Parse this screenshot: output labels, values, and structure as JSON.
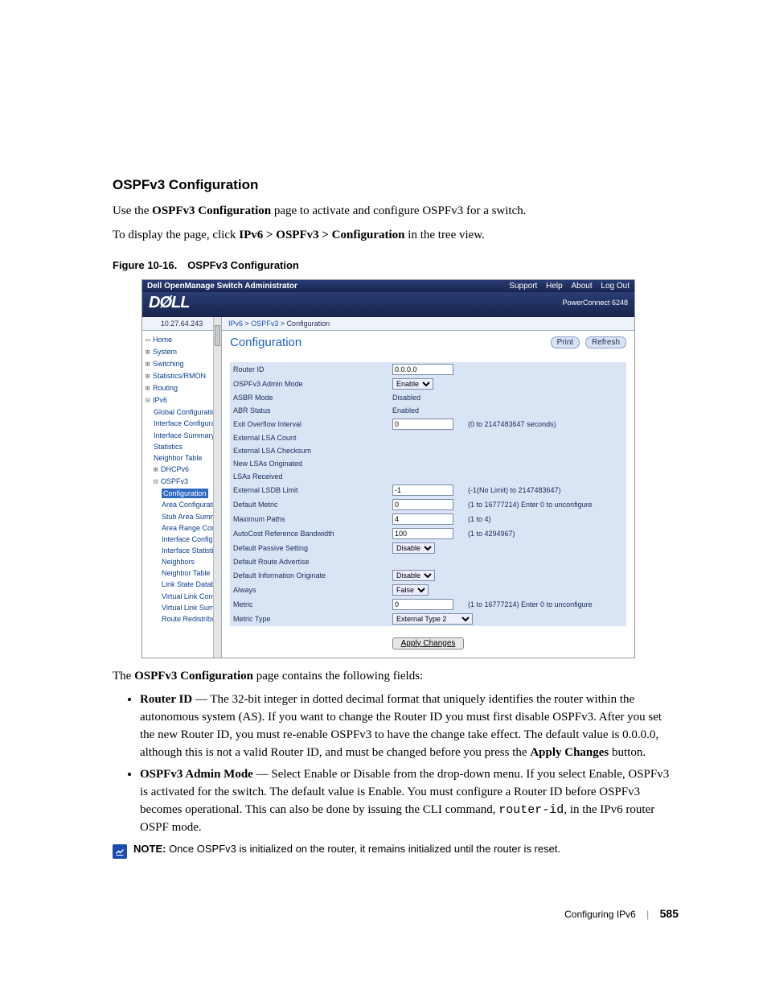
{
  "section_heading": "OSPFv3 Configuration",
  "intro_pre": "Use the ",
  "intro_b": "OSPFv3 Configuration",
  "intro_post": " page to activate and configure OSPFv3 for a switch.",
  "display_pre": "To display the page, click ",
  "display_b": "IPv6 > OSPFv3 > Configuration",
  "display_post": " in the tree view.",
  "figure_caption": "Figure 10-16. OSPFv3 Configuration",
  "shot": {
    "topbar_title": "Dell OpenManage Switch Administrator",
    "topbar_links": {
      "support": "Support",
      "help": "Help",
      "about": "About",
      "logout": "Log Out"
    },
    "logo_text": "DØLL",
    "product": "PowerConnect 6248",
    "ip": "10.27.64.243",
    "breadcrumb": {
      "a": "IPv6",
      "b": "OSPFv3",
      "c": "Configuration"
    },
    "panel_title": "Configuration",
    "panel_print": "Print",
    "panel_refresh": "Refresh",
    "tree": {
      "home": "Home",
      "system": "System",
      "switching": "Switching",
      "stats": "Statistics/RMON",
      "routing": "Routing",
      "ipv6": "IPv6",
      "global": "Global Configuration",
      "ifcfg": "Interface Configurati",
      "ifsum": "Interface Summary",
      "statsn": "Statistics",
      "neigh": "Neighbor Table",
      "dhcpv6": "DHCPv6",
      "ospfv3": "OSPFv3",
      "cfg": "Configuration",
      "areacfg": "Area Configuratio",
      "stubarea": "Stub Area Summ",
      "arearange": "Area Range Conf",
      "ifconf2": "Interface Configu",
      "ifstat2": "Interface Statistic",
      "neighbors": "Neighbors",
      "neightbl": "Neighbor Table",
      "lsdb": "Link State Datab",
      "vlinkconf": "Virtual Link Confi",
      "vlinksum": "Virtual Link Sum",
      "redist": "Route Redistribut"
    },
    "rows": {
      "router_id": {
        "label": "Router ID",
        "value": "0.0.0.0"
      },
      "admin_mode": {
        "label": "OSPFv3 Admin Mode",
        "value": "Enable"
      },
      "asbr_mode": {
        "label": "ASBR Mode",
        "value": "Disabled"
      },
      "abr_status": {
        "label": "ABR Status",
        "value": "Enabled"
      },
      "exit_ovf": {
        "label": "Exit Overflow Interval",
        "value": "0",
        "hint": "(0 to 2147483647 seconds)"
      },
      "ext_lsa": {
        "label": "External LSA Count",
        "value": ""
      },
      "ext_lsa_cks": {
        "label": "External LSA Checksum",
        "value": ""
      },
      "new_lsa": {
        "label": "New LSAs Originated",
        "value": ""
      },
      "lsa_recv": {
        "label": "LSAs Received",
        "value": ""
      },
      "ext_lsdb": {
        "label": "External LSDB Limit",
        "value": "-1",
        "hint": "(-1(No Limit) to 2147483647)"
      },
      "def_metric": {
        "label": "Default Metric",
        "value": "0",
        "hint": "(1 to 16777214) Enter 0 to unconfigure"
      },
      "max_paths": {
        "label": "Maximum Paths",
        "value": "4",
        "hint": "(1 to 4)"
      },
      "auto_bw": {
        "label": "AutoCost Reference Bandwidth",
        "value": "100",
        "hint": "(1 to 4294967)"
      },
      "def_passive": {
        "label": "Default Passive Setting",
        "value": "Disable"
      },
      "def_rt_adv": {
        "label": "Default Route Advertise",
        "value": ""
      },
      "def_info_or": {
        "label": "Default Information Originate",
        "value": "Disable"
      },
      "always": {
        "label": "Always",
        "value": "False"
      },
      "metric": {
        "label": "Metric",
        "value": "0",
        "hint": "(1 to 16777214) Enter 0 to unconfigure"
      },
      "metric_type": {
        "label": "Metric Type",
        "value": "External Type 2"
      }
    },
    "apply": "Apply Changes"
  },
  "fields_intro_pre": "The ",
  "fields_intro_b": "OSPFv3 Configuration",
  "fields_intro_post": " page contains the following fields:",
  "fld1_b": "Router ID",
  "fld1_t1": " — The 32-bit integer in dotted decimal format that uniquely identifies the router within the autonomous system (AS). If you want to change the Router ID you must first disable OSPFv3. After you set the new Router ID, you must re-enable OSPFv3 to have the change take effect. The default value is 0.0.0.0, although this is not a valid Router ID, and must be changed before you press the ",
  "fld1_b2": "Apply Changes",
  "fld1_t2": " button.",
  "fld2_b": "OSPFv3 Admin Mode",
  "fld2_t1": " — Select Enable or Disable from the drop-down menu. If you select Enable, OSPFv3 is activated for the switch. The default value is Enable. You must configure a Router ID before OSPFv3 becomes operational. This can also be done by issuing the CLI command, ",
  "fld2_code": "router-id",
  "fld2_t2": ", in the IPv6 router OSPF mode.",
  "note_label": "NOTE:",
  "note_text": " Once OSPFv3 is initialized on the router, it remains initialized until the router is reset.",
  "footer_section": "Configuring IPv6",
  "footer_page": "585"
}
